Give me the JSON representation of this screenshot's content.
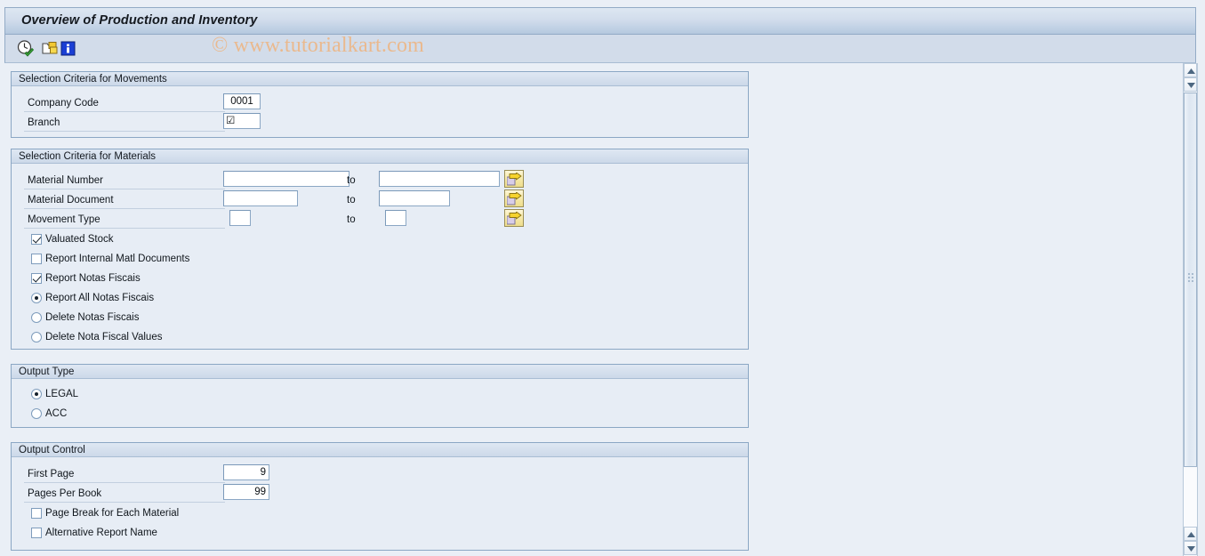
{
  "window": {
    "title": "Overview of Production and Inventory"
  },
  "toolbar": {
    "buttons": [
      {
        "name": "execute-icon",
        "label": "Execute"
      },
      {
        "name": "multiple-selection-icon",
        "label": "Multiple Selection"
      },
      {
        "name": "info-icon",
        "label": "Information"
      }
    ]
  },
  "watermark": {
    "text": "© www.tutorialkart.com",
    "color": "#eab98e"
  },
  "groups": {
    "movements": {
      "title": "Selection Criteria for Movements",
      "fields": [
        {
          "label": "Company Code",
          "value": "0001"
        },
        {
          "label": "Branch",
          "value": "☑"
        }
      ]
    },
    "materials": {
      "title": "Selection Criteria for Materials",
      "range_label": "to",
      "ranges": [
        {
          "label": "Material Number",
          "from": "",
          "to": ""
        },
        {
          "label": "Material Document",
          "from": "",
          "to": ""
        },
        {
          "label": "Movement Type",
          "from": "",
          "to": ""
        }
      ],
      "options": [
        {
          "type": "checkbox",
          "label": "Valuated Stock",
          "checked": true
        },
        {
          "type": "checkbox",
          "label": "Report Internal Matl Documents",
          "checked": false
        },
        {
          "type": "checkbox",
          "label": "Report Notas Fiscais",
          "checked": true
        },
        {
          "type": "radio",
          "label": "Report All Notas Fiscais",
          "checked": true
        },
        {
          "type": "radio",
          "label": "Delete Notas Fiscais",
          "checked": false
        },
        {
          "type": "radio",
          "label": "Delete Nota Fiscal Values",
          "checked": false
        }
      ]
    },
    "output_type": {
      "title": "Output Type",
      "options": [
        {
          "type": "radio",
          "label": "LEGAL",
          "checked": true
        },
        {
          "type": "radio",
          "label": "ACC",
          "checked": false
        }
      ]
    },
    "output_control": {
      "title": "Output Control",
      "fields": [
        {
          "label": "First Page",
          "value": "9"
        },
        {
          "label": "Pages Per Book",
          "value": "99"
        }
      ],
      "options": [
        {
          "type": "checkbox",
          "label": "Page Break for Each Material",
          "checked": false
        },
        {
          "type": "checkbox",
          "label": "Alternative Report Name",
          "checked": false
        }
      ]
    }
  },
  "scrollbar": {
    "up_arrow": "▲",
    "down_arrow": "▼"
  }
}
